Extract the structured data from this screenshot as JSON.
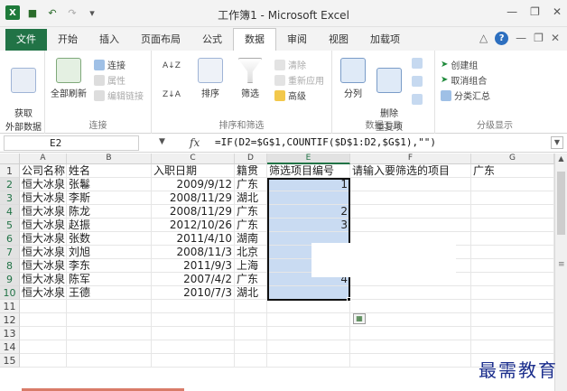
{
  "window": {
    "title": "工作簿1 - Microsoft Excel"
  },
  "quick_access": {
    "icons": [
      "excel-logo-icon",
      "save-icon",
      "undo-icon",
      "redo-icon",
      "customize-icon"
    ]
  },
  "ribbon_tabs": [
    "文件",
    "开始",
    "插入",
    "页面布局",
    "公式",
    "数据",
    "审阅",
    "视图",
    "加载项"
  ],
  "active_tab": "数据",
  "ribbon": {
    "get_external": "获取\n外部数据",
    "refresh_all": "全部刷新",
    "conn_items": [
      "连接",
      "属性",
      "编辑链接"
    ],
    "group_conn": "连接",
    "sort_label": "排序",
    "filter_label": "筛选",
    "filter_items": [
      "清除",
      "重新应用",
      "高级"
    ],
    "group_sort": "排序和筛选",
    "split_label": "分列",
    "remove_dup": "删除\n重复项",
    "group_tools": "数据工具",
    "outline_items": [
      "创建组",
      "取消组合",
      "分类汇总"
    ],
    "group_outline": "分级显示"
  },
  "formula_bar": {
    "name_box": "E2",
    "fx": "fx",
    "formula": "=IF(D2=$G$1,COUNTIF($D$1:D2,$G$1),\"\")"
  },
  "columns": [
    "A",
    "B",
    "C",
    "D",
    "E",
    "F",
    "G"
  ],
  "rows": [
    "1",
    "2",
    "3",
    "4",
    "5",
    "6",
    "7",
    "8",
    "9",
    "10",
    "11",
    "12",
    "13",
    "14",
    "15"
  ],
  "header_row": [
    "公司名称",
    "姓名",
    "入职日期",
    "籍贯",
    "筛选项目编号",
    "请输入要筛选的项目",
    "广东"
  ],
  "data_rows": [
    [
      "恒大冰泉",
      "张鬈",
      "2009/9/12",
      "广东",
      "1"
    ],
    [
      "恒大冰泉",
      "李斯",
      "2008/11/29",
      "湖北",
      ""
    ],
    [
      "恒大冰泉",
      "陈龙",
      "2008/11/29",
      "广东",
      "2"
    ],
    [
      "恒大冰泉",
      "赵振",
      "2012/10/26",
      "广东",
      "3"
    ],
    [
      "恒大冰泉",
      "张数",
      "2011/4/10",
      "湖南",
      ""
    ],
    [
      "恒大冰泉",
      "刘旭",
      "2008/11/3",
      "北京",
      ""
    ],
    [
      "恒大冰泉",
      "李东",
      "2011/9/3",
      "上海",
      ""
    ],
    [
      "恒大冰泉",
      "陈军",
      "2007/4/2",
      "广东",
      "4"
    ],
    [
      "恒大冰泉",
      "王德",
      "2010/7/3",
      "湖北",
      ""
    ]
  ],
  "watermark": "最需教育",
  "colors": {
    "excel_green": "#217346",
    "selection_fill": "#c9dbf2",
    "watermark": "#1a2d8c"
  }
}
